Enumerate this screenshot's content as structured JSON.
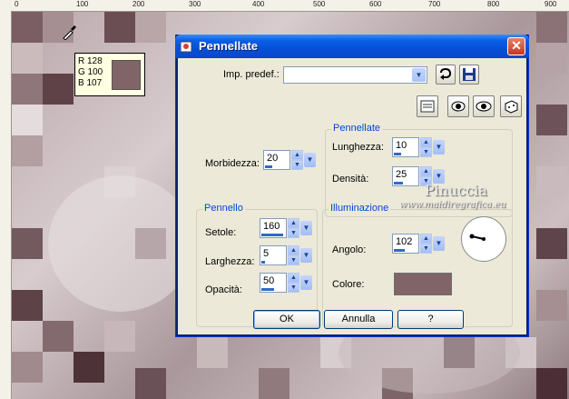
{
  "ruler": {
    "top_marks": [
      "0",
      "100",
      "200",
      "300",
      "400",
      "500",
      "600",
      "700",
      "800",
      "900"
    ]
  },
  "color_tooltip": {
    "r": "R 128",
    "g": "G 100",
    "b": "B 107",
    "swatch": "#806468"
  },
  "dialog": {
    "title": "Pennellate",
    "close_label": "✕",
    "preset_label": "Imp. predef.:",
    "preset_value": "",
    "pennellate_group": {
      "title": "Pennellate",
      "length_label": "Lunghezza:",
      "length_value": "10",
      "density_label": "Densità:",
      "density_value": "25"
    },
    "softness_label": "Morbidezza:",
    "softness_value": "20",
    "brush_group": {
      "title": "Pennello",
      "bristles_label": "Setole:",
      "bristles_value": "160",
      "width_label": "Larghezza:",
      "width_value": "5",
      "opacity_label": "Opacità:",
      "opacity_value": "50"
    },
    "light_group": {
      "title": "Illuminazione",
      "angle_label": "Angolo:",
      "angle_value": "102",
      "color_label": "Colore:",
      "color_value": "#806468"
    },
    "buttons": {
      "ok": "OK",
      "cancel": "Annulla",
      "help": "?"
    }
  },
  "watermark": {
    "name": "Pinuccia",
    "site": "www.maidiregrafica.eu"
  }
}
